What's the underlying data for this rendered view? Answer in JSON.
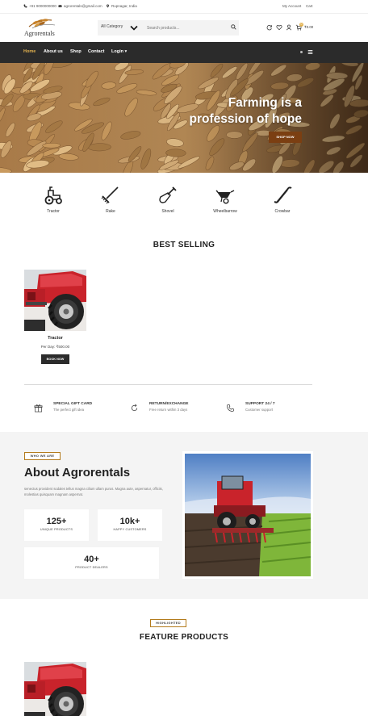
{
  "topbar": {
    "phone": "+91 9000000000",
    "email": "agrorentals@gmail.com",
    "location": "Rupnagar, India",
    "my_account": "My Account",
    "cart": "Cart"
  },
  "header": {
    "logo_text": "Agrorentals",
    "category_select": "All Category",
    "search_placeholder": "Search products...",
    "cart_total": "₹0.00",
    "cart_count": "0",
    "icons": [
      "search-icon",
      "refresh-icon",
      "heart-icon",
      "user-icon",
      "cart-icon"
    ]
  },
  "nav": {
    "items": [
      {
        "label": "Home",
        "active": true
      },
      {
        "label": "About us"
      },
      {
        "label": "Shop"
      },
      {
        "label": "Contact"
      },
      {
        "label": "Login ▾"
      }
    ]
  },
  "hero": {
    "line1": "Farming is a",
    "line2": "profession of hope",
    "button": "SHOP NOW"
  },
  "categories": [
    {
      "label": "Tractor",
      "icon": "tractor-icon"
    },
    {
      "label": "Rake",
      "icon": "rake-icon"
    },
    {
      "label": "Shovel",
      "icon": "shovel-icon"
    },
    {
      "label": "Wheelbarrow",
      "icon": "wheelbarrow-icon"
    },
    {
      "label": "Crowbar",
      "icon": "crowbar-icon"
    }
  ],
  "best_selling": {
    "title": "BEST SELLING",
    "product": {
      "name": "Tractor",
      "price": "Per Day: ₹500.00",
      "button": "BOOK NOW"
    }
  },
  "features": [
    {
      "title": "SPECIAL GIFT CARD",
      "subtitle": "The perfect gift idea",
      "icon": "gift-icon"
    },
    {
      "title": "RETURN/EXCHANGE",
      "subtitle": "Free return within 3 days",
      "icon": "return-icon"
    },
    {
      "title": "SUPPORT 24 / 7",
      "subtitle": "Customer support",
      "icon": "phone-icon"
    }
  ],
  "about": {
    "badge": "WHO WE ARE",
    "title": "About Agrorentals",
    "description": "senectus provident sodales tellus magna cilium ullam purus. Magna aute, aspernatur, officiis, molestias quisquam magnam aspernat.",
    "stats": [
      {
        "number": "125+",
        "label": "UNIQUE PRODUCTS"
      },
      {
        "number": "10k+",
        "label": "HAPPY CUSTOMERS"
      },
      {
        "number": "40+",
        "label": "PRODUCT DEALERS"
      }
    ]
  },
  "feature_products": {
    "badge": "HIGHLIGHTED",
    "title": "FEATURE PRODUCTS"
  },
  "colors": {
    "nav_bg": "#2b2b2b",
    "accent": "#e3b24f",
    "brown": "#7b3f12",
    "badge_border": "#b37b1d"
  }
}
